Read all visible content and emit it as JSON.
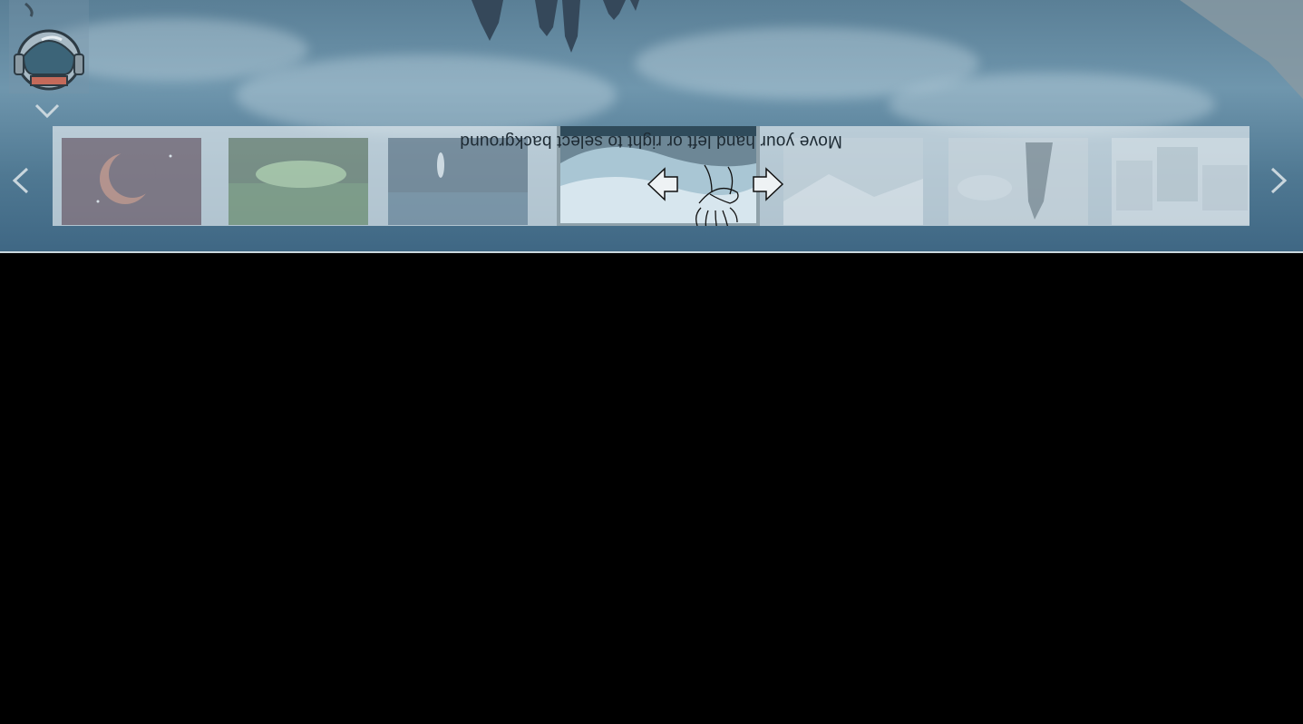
{
  "window": {
    "title": ""
  },
  "background_picker": {
    "instruction": "Move your hand left or right to select background",
    "selected_index": 3,
    "thumbnails": [
      {
        "name": "space-planet"
      },
      {
        "name": "forest"
      },
      {
        "name": "night-light"
      },
      {
        "name": "ocean-wave"
      },
      {
        "name": "snow-mountain"
      },
      {
        "name": "floating-island"
      },
      {
        "name": "city-buildings"
      }
    ]
  },
  "icons": {
    "avatar": "astronaut-helmet-icon",
    "expand": "chevron-down-icon",
    "prev": "chevron-left-icon",
    "next": "chevron-right-icon",
    "gesture": "hand-gesture-icon",
    "arrow_left": "arrow-left-icon",
    "arrow_right": "arrow-right-icon"
  },
  "colors": {
    "page_background": "#000000",
    "panel": "#dce6ec",
    "sky": "#5a7f96"
  }
}
